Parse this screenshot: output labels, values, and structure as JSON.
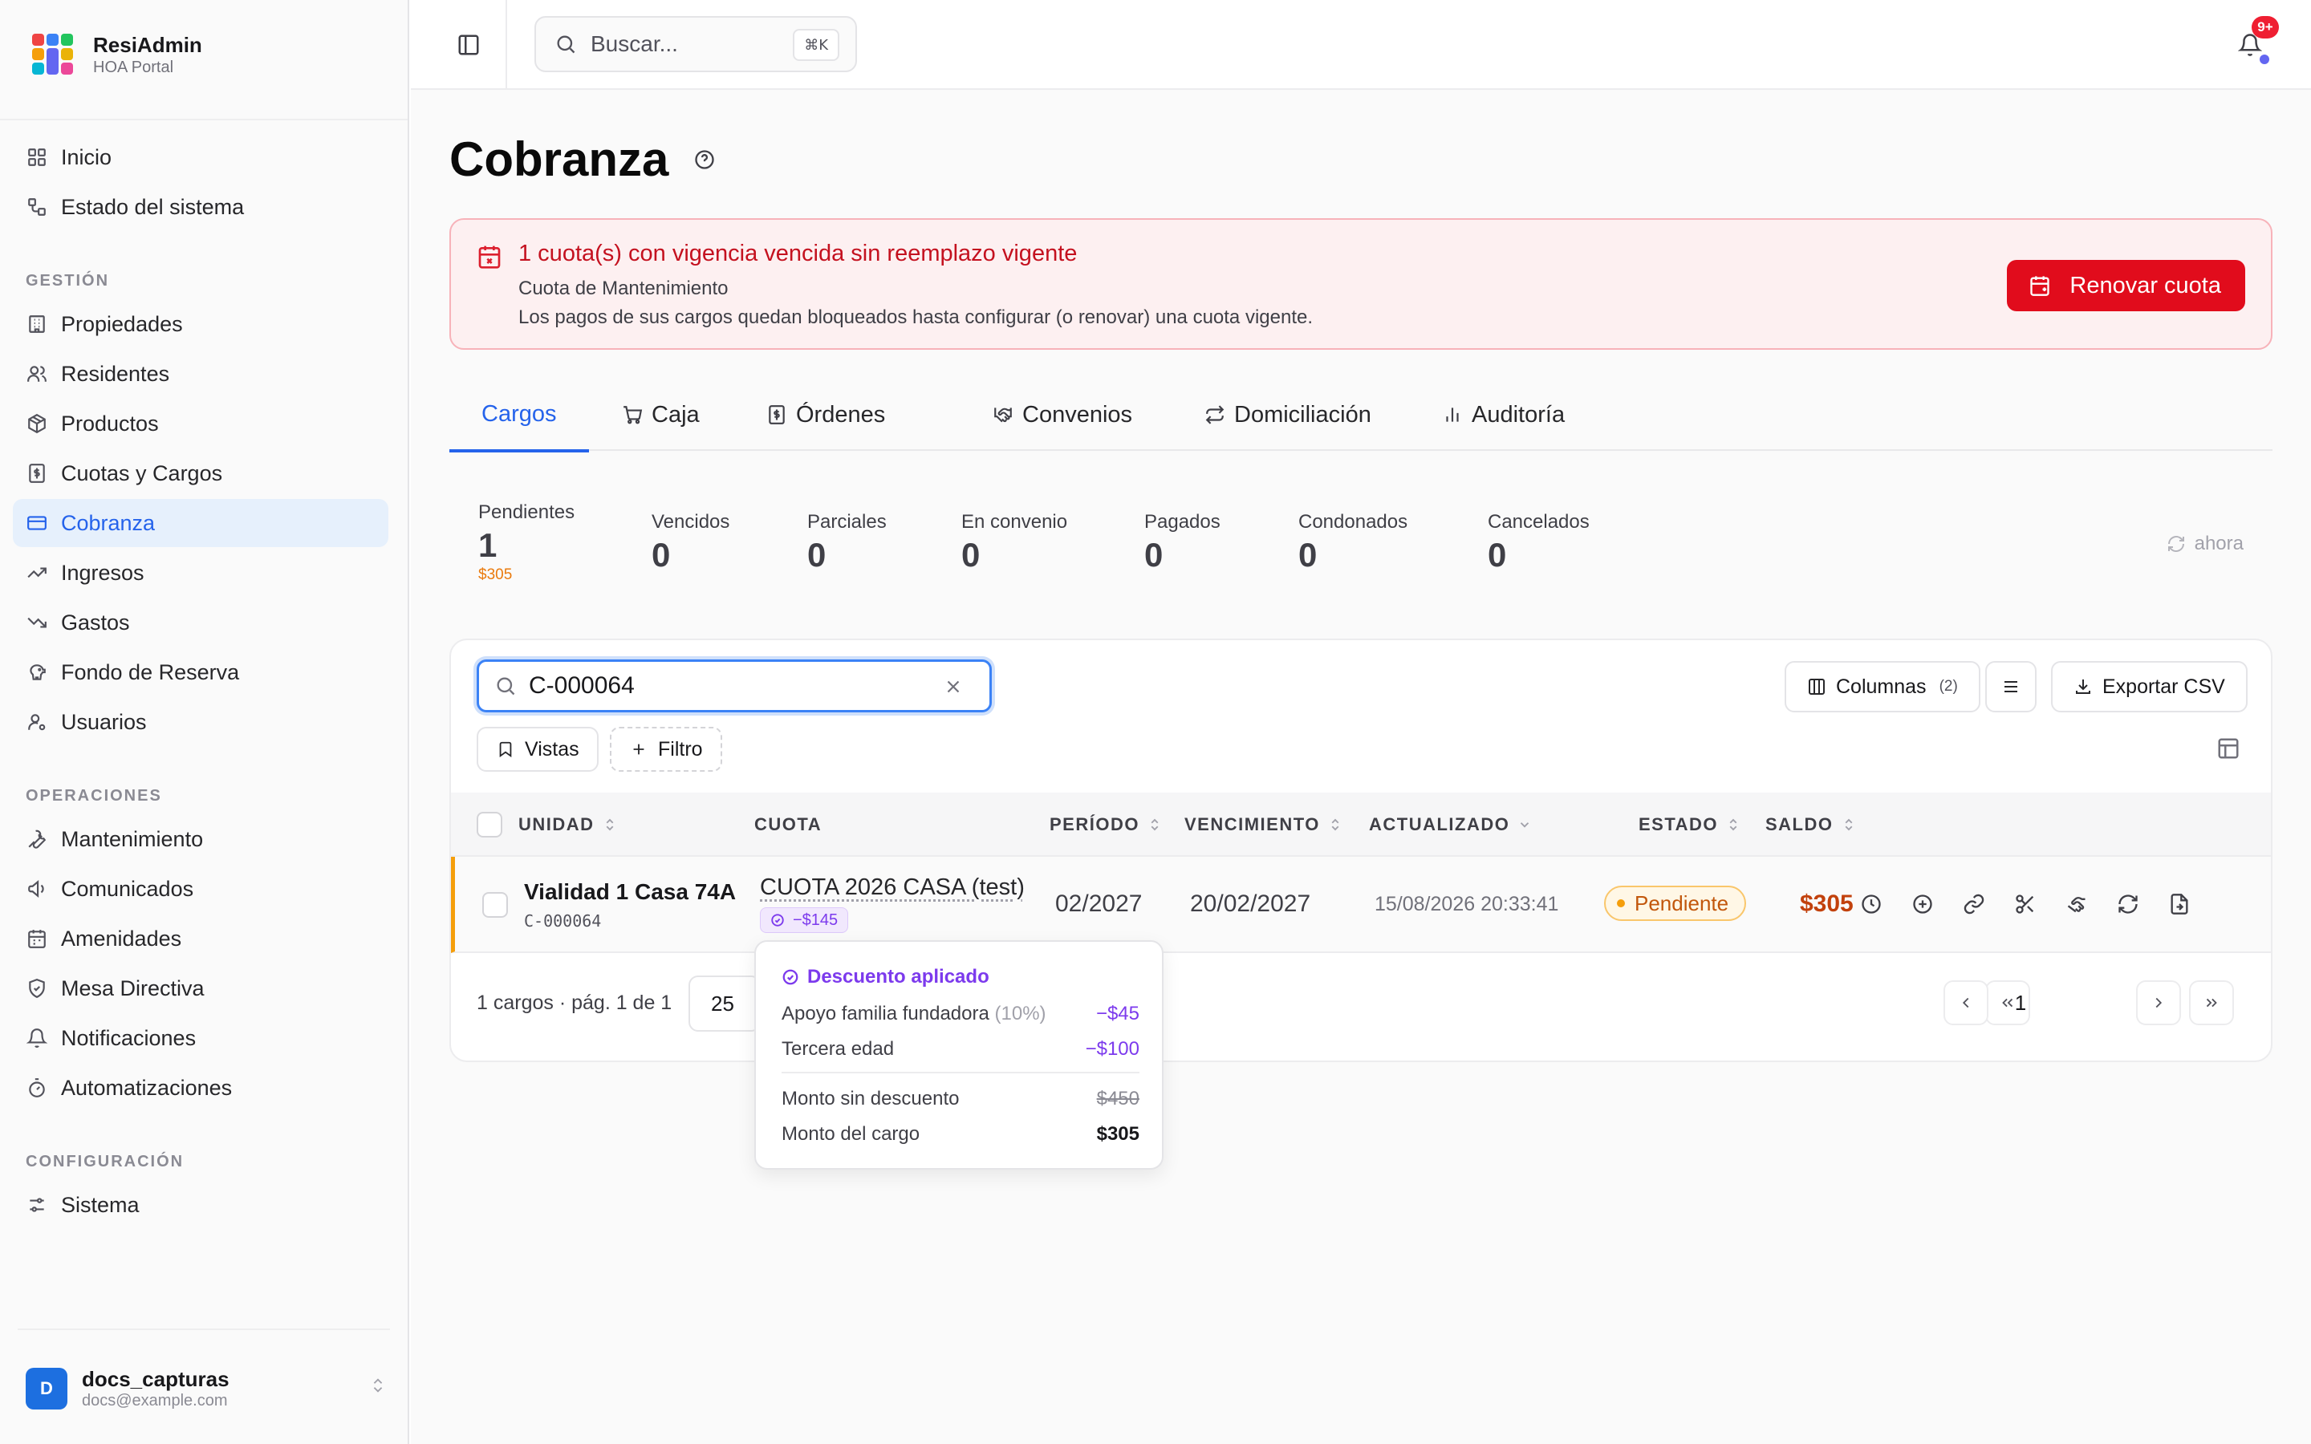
{
  "brand": {
    "name": "ResiAdmin",
    "subtitle": "HOA Portal"
  },
  "nav": {
    "top": [
      {
        "label": "Inicio",
        "icon": "grid-icon"
      },
      {
        "label": "Estado del sistema",
        "icon": "workflow-icon"
      }
    ],
    "sections": [
      {
        "title": "GESTIÓN",
        "items": [
          {
            "label": "Propiedades",
            "icon": "building-icon"
          },
          {
            "label": "Residentes",
            "icon": "users-icon"
          },
          {
            "label": "Productos",
            "icon": "package-icon"
          },
          {
            "label": "Cuotas y Cargos",
            "icon": "receipt-icon"
          },
          {
            "label": "Cobranza",
            "icon": "credit-card-icon",
            "active": true
          },
          {
            "label": "Ingresos",
            "icon": "trending-up-icon"
          },
          {
            "label": "Gastos",
            "icon": "trending-down-icon"
          },
          {
            "label": "Fondo de Reserva",
            "icon": "piggy-bank-icon"
          },
          {
            "label": "Usuarios",
            "icon": "user-cog-icon"
          }
        ]
      },
      {
        "title": "OPERACIONES",
        "items": [
          {
            "label": "Mantenimiento",
            "icon": "wrench-icon"
          },
          {
            "label": "Comunicados",
            "icon": "megaphone-icon"
          },
          {
            "label": "Amenidades",
            "icon": "calendar-icon"
          },
          {
            "label": "Mesa Directiva",
            "icon": "shield-icon"
          },
          {
            "label": "Notificaciones",
            "icon": "bell-icon"
          },
          {
            "label": "Automatizaciones",
            "icon": "timer-icon"
          }
        ]
      },
      {
        "title": "CONFIGURACIÓN",
        "items": [
          {
            "label": "Sistema",
            "icon": "settings-sliders-icon"
          }
        ]
      }
    ]
  },
  "user": {
    "initial": "D",
    "name": "docs_capturas",
    "email": "docs@example.com"
  },
  "topbar": {
    "search_placeholder": "Buscar...",
    "shortcut": "⌘K",
    "notif_count": "9+"
  },
  "page": {
    "title": "Cobranza"
  },
  "alert": {
    "title": "1 cuota(s) con vigencia vencida sin reemplazo vigente",
    "line1": "Cuota de Mantenimiento",
    "line2": "Los pagos de sus cargos quedan bloqueados hasta configurar (o renovar) una cuota vigente.",
    "button": "Renovar cuota"
  },
  "tabs": [
    {
      "label": "Cargos",
      "icon": "",
      "active": true
    },
    {
      "label": "Caja",
      "icon": "cart-icon"
    },
    {
      "label": "Órdenes",
      "icon": "receipt-icon"
    },
    {
      "label": "Convenios",
      "icon": "handshake-icon"
    },
    {
      "label": "Domiciliación",
      "icon": "repeat-icon"
    },
    {
      "label": "Auditoría",
      "icon": "bar-chart-icon"
    }
  ],
  "stats": [
    {
      "label": "Pendientes",
      "value": "1",
      "sub": "$305"
    },
    {
      "label": "Vencidos",
      "value": "0"
    },
    {
      "label": "Parciales",
      "value": "0"
    },
    {
      "label": "En convenio",
      "value": "0"
    },
    {
      "label": "Pagados",
      "value": "0"
    },
    {
      "label": "Condonados",
      "value": "0"
    },
    {
      "label": "Cancelados",
      "value": "0"
    }
  ],
  "refresh_label": "ahora",
  "toolbar": {
    "filter_value": "C-000064",
    "columns_label": "Columnas",
    "columns_count": "(2)",
    "export_label": "Exportar CSV",
    "views_label": "Vistas",
    "filter_label": "Filtro"
  },
  "table": {
    "headers": {
      "unit": "UNIDAD",
      "cuota": "CUOTA",
      "period": "PERÍODO",
      "due": "VENCIMIENTO",
      "updated": "ACTUALIZADO",
      "status": "ESTADO",
      "balance": "SALDO"
    },
    "rows": [
      {
        "unit": "Vialidad 1 Casa 74A",
        "code": "C-000064",
        "cuota": "CUOTA 2026 CASA (test)",
        "discount": "−$145",
        "period": "02/2027",
        "due": "20/02/2027",
        "updated": "15/08/2026 20:33:41",
        "status": "Pendiente",
        "balance": "$305"
      }
    ]
  },
  "footer": {
    "summary": "1 cargos · pág. 1 de 1",
    "page_size": "25",
    "current_page": "1"
  },
  "tooltip": {
    "title": "Descuento aplicado",
    "items": [
      {
        "label": "Apoyo familia fundadora",
        "pct": "(10%)",
        "amount": "−$45"
      },
      {
        "label": "Tercera edad",
        "pct": "",
        "amount": "−$100"
      }
    ],
    "subtotal_label": "Monto sin descuento",
    "subtotal_value": "$450",
    "total_label": "Monto del cargo",
    "total_value": "$305"
  },
  "colors": {
    "accent": "#2563eb",
    "danger": "#e10c1c",
    "warning": "#f59e0b",
    "discount": "#7c3aed"
  }
}
